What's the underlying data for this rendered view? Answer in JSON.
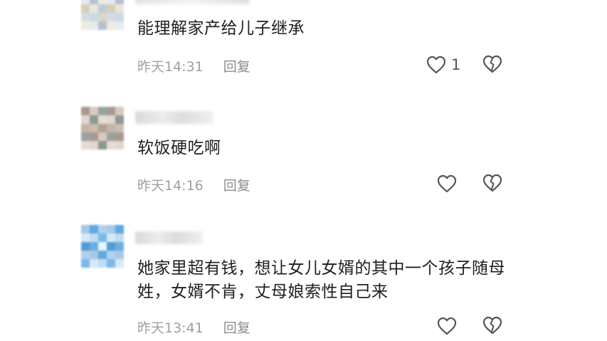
{
  "comments": [
    {
      "text": "能理解家产给儿子继承",
      "time": "昨天14:31",
      "reply_label": "回复",
      "like_count": "1",
      "avatar_colors": [
        "#c7d5e0",
        "#e8e4d8",
        "#aebccb",
        "#d9d2c0",
        "#b8c7d6",
        "#efe9dc",
        "#cfd9e3",
        "#d4c9b4",
        "#e3e8ee"
      ]
    },
    {
      "text": "软饭硬吃啊",
      "time": "昨天14:16",
      "reply_label": "回复",
      "like_count": "",
      "avatar_colors": [
        "#9e8f86",
        "#c8b6a8",
        "#7f8f8a",
        "#d8c4b8",
        "#a99890",
        "#e6d8cc",
        "#8d9a96",
        "#c0aca0",
        "#dfd2c8"
      ]
    },
    {
      "text": "她家里超有钱，想让女儿女婿的其中一个孩子随母姓，女婿不肯，丈母娘索性自己来",
      "time": "昨天13:41",
      "reply_label": "回复",
      "like_count": "",
      "avatar_colors": [
        "#9cc4e4",
        "#5aa7e0",
        "#bcd9ef",
        "#4f9fda",
        "#e8f2fa",
        "#6cb3e6",
        "#a7cde9",
        "#3f92d2",
        "#d3e7f6"
      ]
    }
  ],
  "icons": {
    "like": "heart-outline-icon",
    "dislike": "broken-heart-icon"
  },
  "colors": {
    "text": "#1f1f1f",
    "meta": "#a0a0a0",
    "icon": "#555555"
  }
}
